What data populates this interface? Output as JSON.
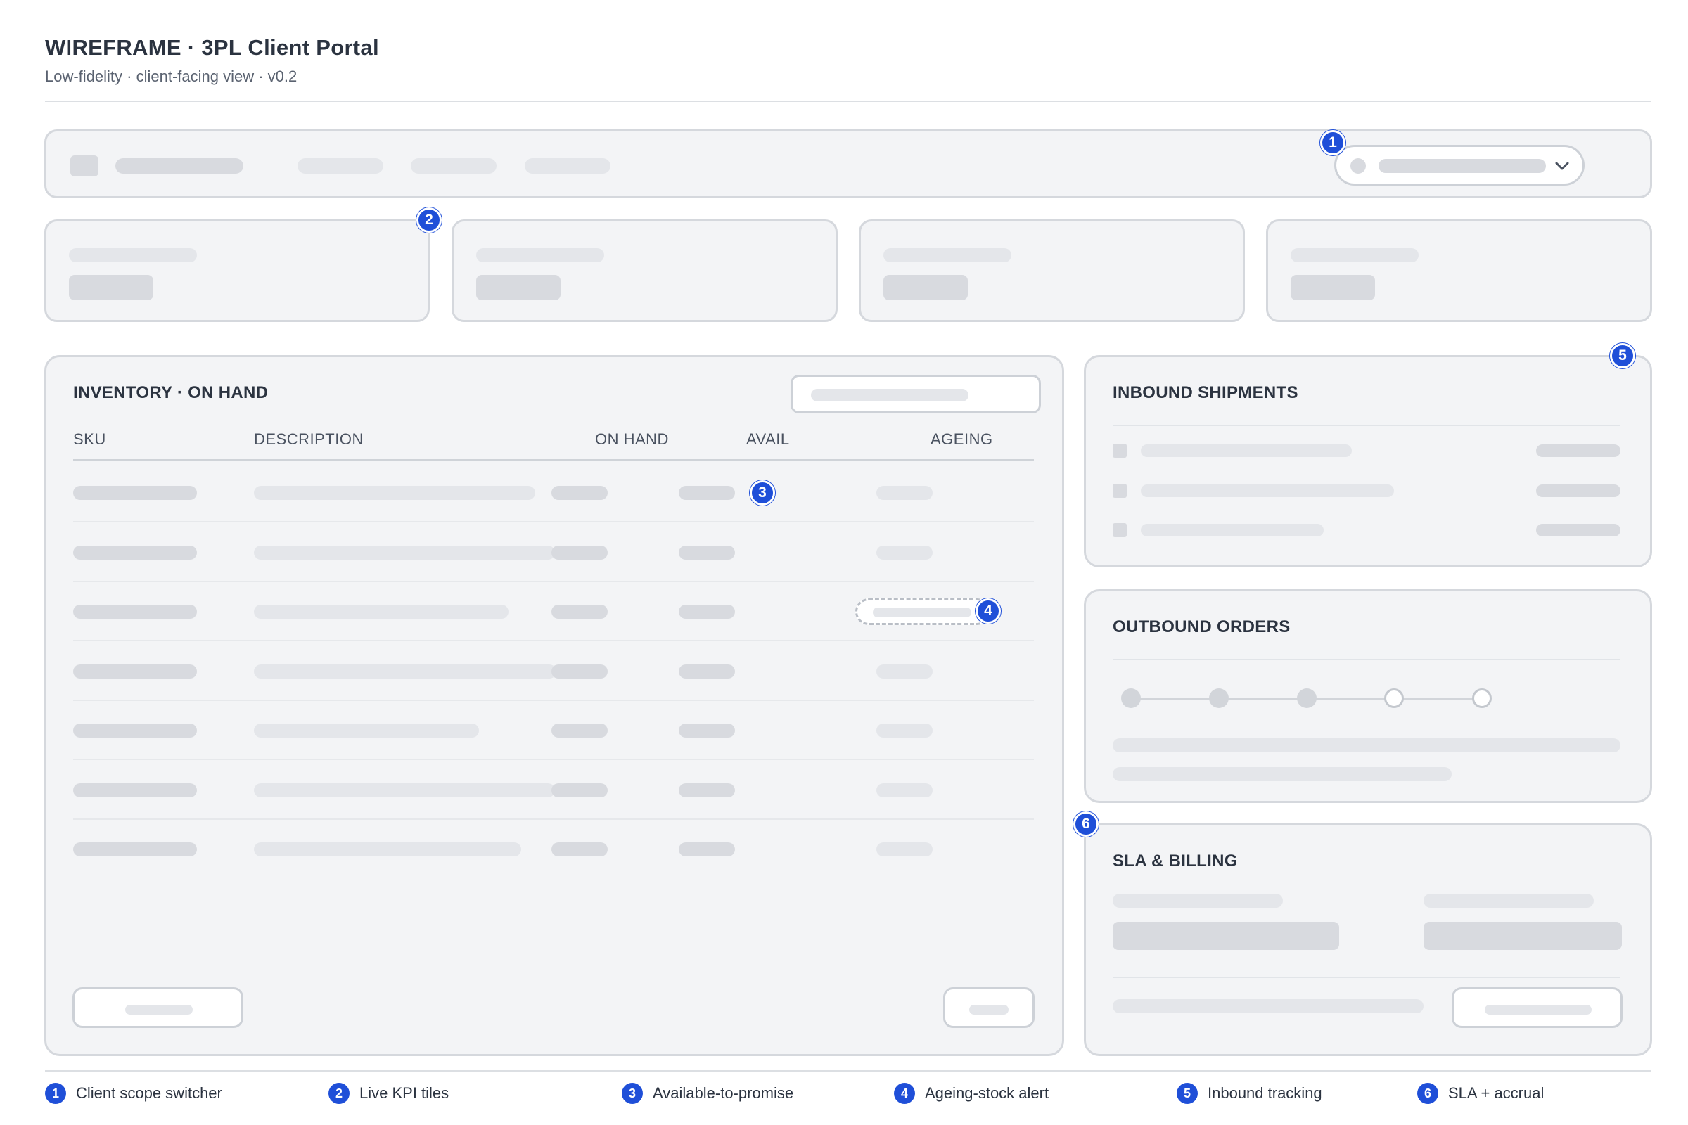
{
  "header": {
    "title": "WIREFRAME · 3PL Client Portal",
    "subtitle": "Low-fidelity · client-facing view · v0.2"
  },
  "inventory": {
    "title": "INVENTORY · ON HAND",
    "columns": [
      "SKU",
      "DESCRIPTION",
      "ON HAND",
      "AVAIL",
      "AGEING"
    ],
    "row_count": 7
  },
  "inbound": {
    "title": "INBOUND SHIPMENTS"
  },
  "outbound": {
    "title": "OUTBOUND ORDERS",
    "steps_total": 5,
    "steps_done": 3
  },
  "sla": {
    "title": "SLA & BILLING"
  },
  "badges": [
    "1",
    "2",
    "3",
    "4",
    "5",
    "6"
  ],
  "legend": [
    {
      "num": "1",
      "label": "Client scope switcher"
    },
    {
      "num": "2",
      "label": "Live KPI tiles"
    },
    {
      "num": "3",
      "label": "Available-to-promise"
    },
    {
      "num": "4",
      "label": "Ageing-stock alert"
    },
    {
      "num": "5",
      "label": "Inbound tracking"
    },
    {
      "num": "6",
      "label": "SLA + accrual"
    }
  ],
  "colors": {
    "badge": "#1f4fd8",
    "panel_bg": "#f3f4f6",
    "panel_border": "#d5d8dd",
    "skeleton": "#e4e6ea"
  }
}
